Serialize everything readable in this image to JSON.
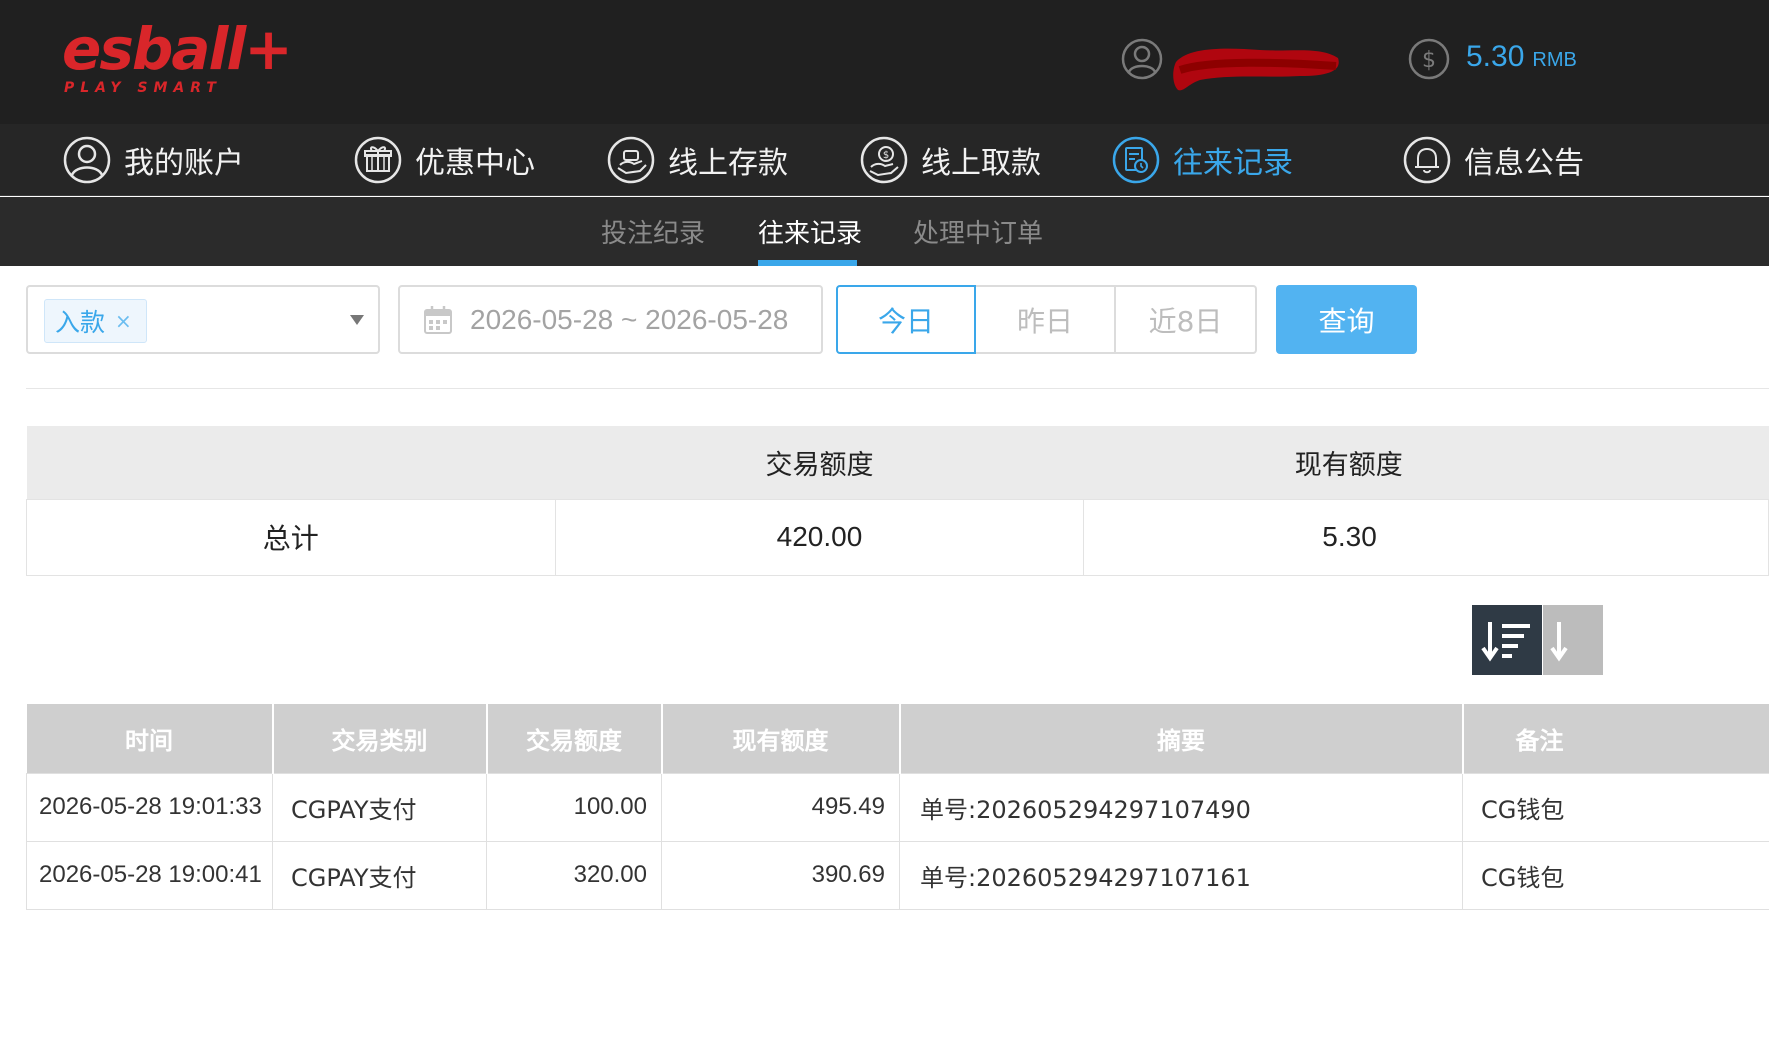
{
  "header": {
    "logo_main": "esball+",
    "logo_sub": "PLAY SMART",
    "balance_value": "5.30",
    "balance_currency": "RMB"
  },
  "nav": {
    "items": [
      {
        "label": "我的账户",
        "icon": "user-circle-icon"
      },
      {
        "label": "优惠中心",
        "icon": "gift-icon"
      },
      {
        "label": "线上存款",
        "icon": "deposit-icon"
      },
      {
        "label": "线上取款",
        "icon": "withdraw-icon"
      },
      {
        "label": "往来记录",
        "icon": "records-icon",
        "active": true
      },
      {
        "label": "信息公告",
        "icon": "bell-icon"
      }
    ],
    "active_color": "#3aa7ea"
  },
  "subnav": {
    "items": [
      {
        "label": "投注纪录"
      },
      {
        "label": "往来记录",
        "active": true
      },
      {
        "label": "处理中订单"
      }
    ]
  },
  "filters": {
    "type_tag": "入款",
    "tag_close": "×",
    "date_range": "2026-05-28 ~ 2026-05-28",
    "ranges": [
      "今日",
      "昨日",
      "近8日"
    ],
    "active_range": "今日",
    "query_label": "查询"
  },
  "summary": {
    "headers": [
      "",
      "交易额度",
      "现有额度"
    ],
    "total_label": "总计",
    "total_amount": "420.00",
    "current_amount": "5.30"
  },
  "records": {
    "headers": [
      "时间",
      "交易类别",
      "交易额度",
      "现有额度",
      "摘要",
      "备注"
    ],
    "rows": [
      {
        "time": "2026-05-28 19:01:33",
        "type": "CGPAY支付",
        "amount": "100.00",
        "balance": "495.49",
        "summary": "单号:202605294297107490",
        "note": "CG钱包"
      },
      {
        "time": "2026-05-28 19:00:41",
        "type": "CGPAY支付",
        "amount": "320.00",
        "balance": "390.69",
        "summary": "单号:202605294297107161",
        "note": "CG钱包"
      }
    ]
  },
  "colors": {
    "accent": "#3aa7ea",
    "logo_red": "#d9262a",
    "header_bg": "#202020"
  }
}
